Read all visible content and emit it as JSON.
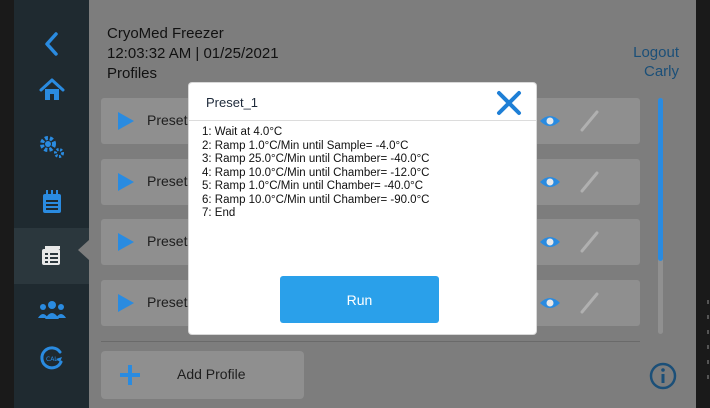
{
  "header": {
    "app_title": "CryoMed Freezer",
    "datetime": "12:03:32 AM | 01/25/2021",
    "page_title": "Profiles"
  },
  "user": {
    "logout_label": "Logout",
    "username": "Carly"
  },
  "sidebar": {
    "items": [
      {
        "icon": "back-chevron-icon"
      },
      {
        "icon": "home-icon"
      },
      {
        "icon": "settings-gears-icon"
      },
      {
        "icon": "calendar-icon"
      },
      {
        "icon": "profiles-list-icon",
        "active": true
      },
      {
        "icon": "users-group-icon"
      },
      {
        "icon": "calibration-icon"
      }
    ]
  },
  "profiles": {
    "rows": [
      {
        "name": "Preset"
      },
      {
        "name": "Preset"
      },
      {
        "name": "Preset"
      },
      {
        "name": "Preset"
      }
    ],
    "add_label": "Add Profile"
  },
  "modal": {
    "title": "Preset_1",
    "steps": [
      "1: Wait at 4.0°C",
      "2: Ramp 1.0°C/Min until Sample= -4.0°C",
      "3: Ramp 25.0°C/Min until Chamber= -40.0°C",
      "4: Ramp 10.0°C/Min until Chamber= -12.0°C",
      "5: Ramp 1.0°C/Min until Chamber= -40.0°C",
      "6: Ramp 10.0°C/Min until Chamber= -90.0°C",
      "7: End"
    ],
    "run_label": "Run"
  },
  "scrollbar": {
    "position_fraction": 0.0,
    "visible_fraction": 0.69
  },
  "colors": {
    "accent_blue": "#2a8be0",
    "run_button": "#2aa0ea",
    "close_x": "#1e7fd6",
    "sidebar_bg": "#1f2a30",
    "overlay_bg": "#7d7d7d"
  }
}
